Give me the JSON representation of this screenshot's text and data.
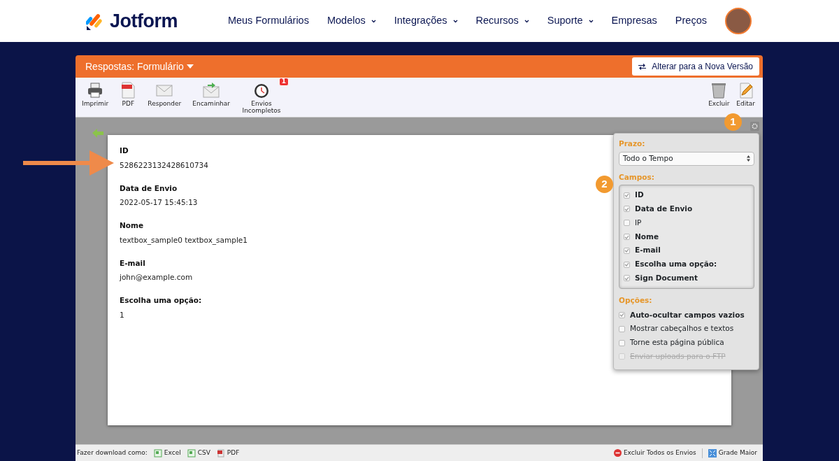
{
  "brand": {
    "name": "Jotform"
  },
  "nav": [
    {
      "label": "Meus Formulários",
      "caret": false
    },
    {
      "label": "Modelos",
      "caret": true
    },
    {
      "label": "Integrações",
      "caret": true
    },
    {
      "label": "Recursos",
      "caret": true
    },
    {
      "label": "Suporte",
      "caret": true
    },
    {
      "label": "Empresas",
      "caret": false
    },
    {
      "label": "Preços",
      "caret": false
    }
  ],
  "header": {
    "title": "Respostas: Formulário",
    "switch_button": "Alterar para a Nova Versão"
  },
  "toolbar_left": [
    {
      "kind": "print",
      "label": "Imprimir"
    },
    {
      "kind": "pdf",
      "label": "PDF"
    },
    {
      "kind": "reply",
      "label": "Responder"
    },
    {
      "kind": "forward",
      "label": "Encaminhar"
    },
    {
      "kind": "incomplete",
      "label": "Envios Incompletos",
      "badge": "1"
    }
  ],
  "toolbar_right": [
    {
      "kind": "delete",
      "label": "Excluir"
    },
    {
      "kind": "edit",
      "label": "Editar"
    }
  ],
  "submission": [
    {
      "label": "ID",
      "value": "5286223132428610734"
    },
    {
      "label": "Data de Envio",
      "value": "2022-05-17 15:45:13"
    },
    {
      "label": "Nome",
      "value": "textbox_sample0 textbox_sample1"
    },
    {
      "label": "E-mail",
      "value": "john@example.com"
    },
    {
      "label": "Escolha uma opção:",
      "value": "1"
    }
  ],
  "settings": {
    "period_label": "Prazo:",
    "period_value": "Todo o Tempo",
    "fields_label": "Campos:",
    "fields": [
      {
        "label": "ID",
        "checked": true
      },
      {
        "label": "Data de Envio",
        "checked": true
      },
      {
        "label": "IP",
        "checked": false
      },
      {
        "label": "Nome",
        "checked": true
      },
      {
        "label": "E-mail",
        "checked": true
      },
      {
        "label": "Escolha uma opção:",
        "checked": true
      },
      {
        "label": "Sign Document",
        "checked": true
      }
    ],
    "options_label": "Opções:",
    "options": [
      {
        "label": "Auto-ocultar campos vazios",
        "checked": true,
        "disabled": false
      },
      {
        "label": "Mostrar cabeçalhos e textos",
        "checked": false,
        "disabled": false
      },
      {
        "label": "Torne esta página pública",
        "checked": false,
        "disabled": false
      },
      {
        "label": "Enviar uploads para o FTP",
        "checked": false,
        "disabled": true
      }
    ]
  },
  "footer": {
    "download_label": "Fazer download como:",
    "downloads": [
      {
        "kind": "excel",
        "label": "Excel"
      },
      {
        "kind": "csv",
        "label": "CSV"
      },
      {
        "kind": "pdf",
        "label": "PDF"
      }
    ],
    "delete_all": "Excluir Todos os Envios",
    "grid": "Grade Maior"
  },
  "annotations": [
    {
      "label": "1"
    },
    {
      "label": "2"
    }
  ]
}
